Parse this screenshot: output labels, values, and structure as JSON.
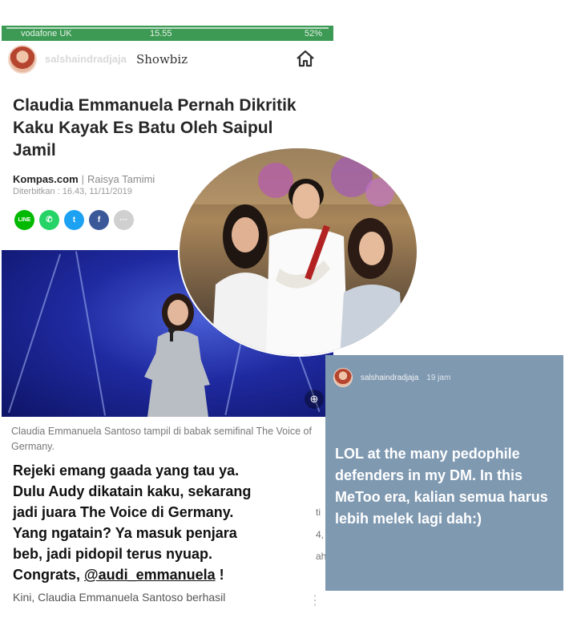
{
  "status_bar": {
    "carrier": "vodafone UK",
    "time": "15.55",
    "battery": "52%"
  },
  "story": {
    "username": "salshaindradjaja",
    "section": "Showbiz"
  },
  "article": {
    "headline": "Claudia Emmanuela Pernah Dikritik Kaku Kayak Es Batu Oleh Saipul Jamil",
    "source": "Kompas.com",
    "author": "Raisya Tamimi",
    "published": "Diterbitkan : 16.43, 11/11/2019",
    "caption": "Claudia Emmanuela Santoso tampil di babak semifinal The Voice of Germany.",
    "bottom_line": "Kini, Claudia Emmanuela Santoso berhasil"
  },
  "share_buttons": [
    {
      "icon": "line-icon",
      "color": "#00b900",
      "glyph": "LINE"
    },
    {
      "icon": "whatsapp-icon",
      "color": "#25d366",
      "glyph": "✆"
    },
    {
      "icon": "twitter-icon",
      "color": "#1da1f2",
      "glyph": "t"
    },
    {
      "icon": "facebook-icon",
      "color": "#3b5998",
      "glyph": "f"
    },
    {
      "icon": "more-icon",
      "color": "#d0d0d0",
      "glyph": "···"
    }
  ],
  "overlay": {
    "line1": "Rejeki emang gaada yang tau ya.",
    "line2": "Dulu Audy dikatain kaku, sekarang",
    "line3": "jadi juara The Voice di Germany.",
    "line4": "Yang ngatain? Ya masuk penjara",
    "line5": "beb, jadi pidopil terus nyuap.",
    "line6_prefix": "Congrats, ",
    "mention": "@audi_emmanuela",
    "line6_suffix": " !"
  },
  "right_story": {
    "username": "salshaindradjaja",
    "time": "19 jam",
    "text": "LOL at the many pedophile defenders in my DM. In this MeToo era, kalian semua harus lebih melek lagi dah:)"
  }
}
